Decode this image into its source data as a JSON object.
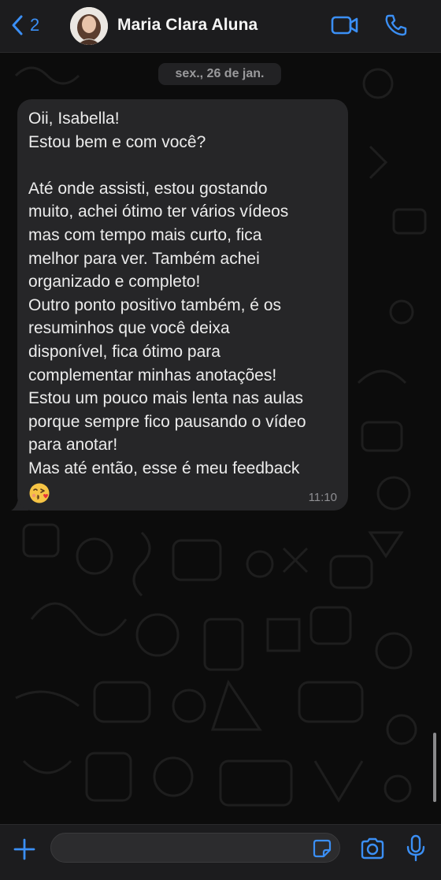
{
  "header": {
    "back_count": "2",
    "contact_name": "Maria Clara Aluna",
    "icons": [
      "chevron-left-icon",
      "video-camera-icon",
      "phone-icon"
    ]
  },
  "chat": {
    "date_label": "sex., 26 de jan.",
    "message": {
      "lines": [
        "Oii, Isabella!",
        "Estou bem e com você?",
        "",
        "Até onde assisti, estou gostando",
        "muito, achei ótimo ter vários vídeos",
        "mas com tempo mais curto, fica",
        "melhor para ver. Também achei",
        "organizado e completo!",
        "Outro ponto positivo também, é os",
        "resuminhos que você deixa",
        "disponível, fica ótimo para",
        "complementar minhas anotações!",
        "Estou um pouco mais lenta nas aulas",
        "porque sempre fico pausando o vídeo",
        "para anotar!",
        "Mas até então, esse é meu feedback"
      ],
      "emoji": "😘",
      "time": "11:10"
    }
  },
  "composer": {
    "value": "",
    "icons": [
      "plus-icon",
      "sticker-icon",
      "camera-icon",
      "microphone-icon"
    ]
  },
  "colors": {
    "accent": "#3b8ff5",
    "bubble": "#262628",
    "bar": "#1c1c1e"
  }
}
